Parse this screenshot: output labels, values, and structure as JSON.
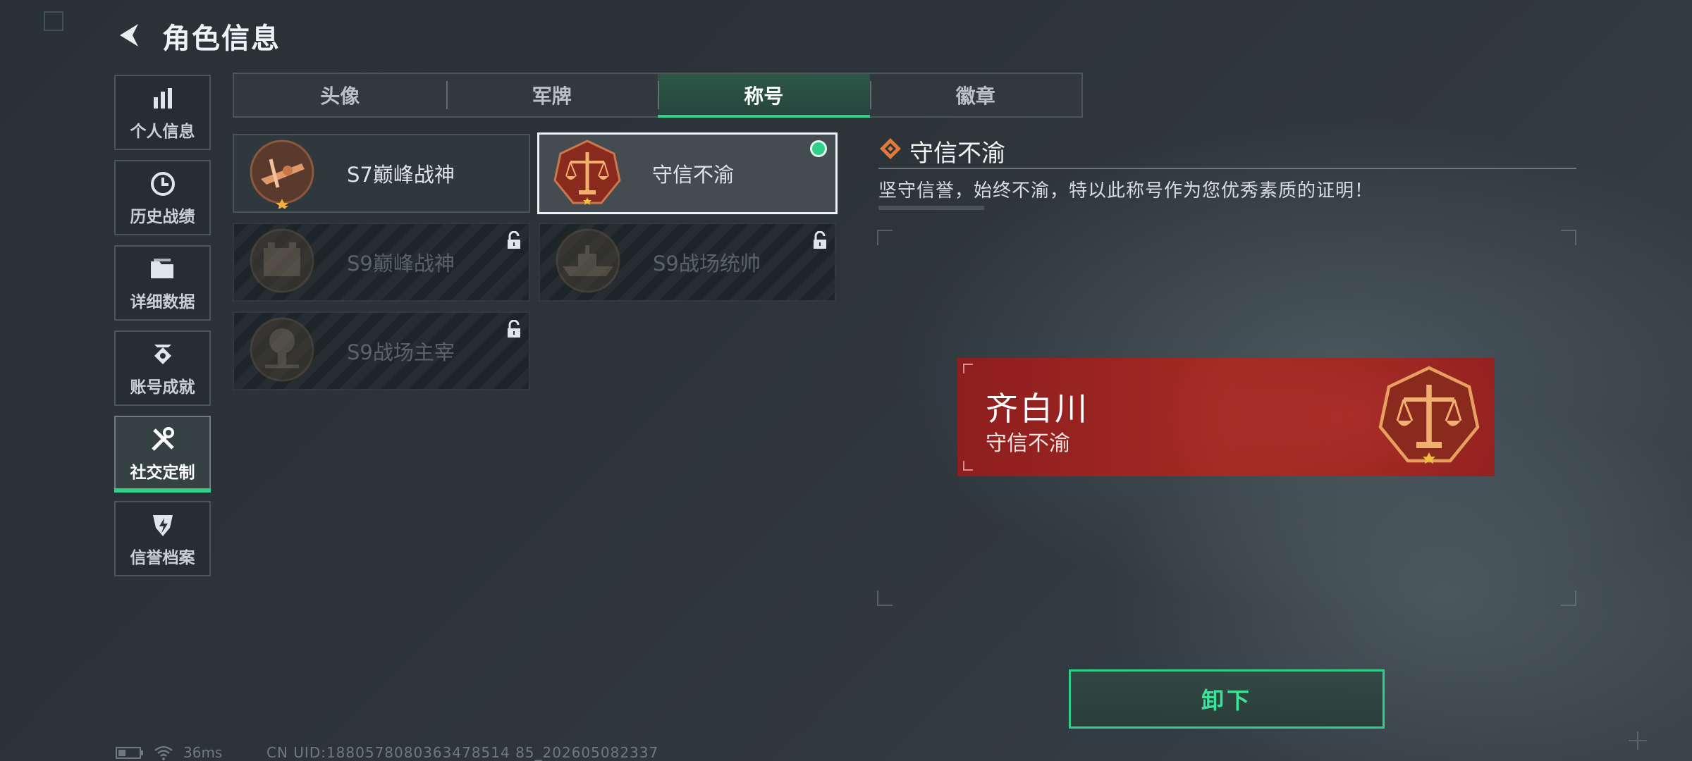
{
  "header": {
    "title": "角色信息",
    "back_icon": "back-arrow-icon"
  },
  "sidebar": {
    "items": [
      {
        "label": "个人信息",
        "icon": "bar-chart-icon",
        "active": false
      },
      {
        "label": "历史战绩",
        "icon": "clock-icon",
        "active": false
      },
      {
        "label": "详细数据",
        "icon": "folder-icon",
        "active": false
      },
      {
        "label": "账号成就",
        "icon": "badge-icon",
        "active": false
      },
      {
        "label": "社交定制",
        "icon": "tools-icon",
        "active": true
      },
      {
        "label": "信誉档案",
        "icon": "shield-bolt-icon",
        "active": false
      }
    ]
  },
  "tabs": [
    {
      "label": "头像",
      "active": false
    },
    {
      "label": "军牌",
      "active": false
    },
    {
      "label": "称号",
      "active": true
    },
    {
      "label": "徽章",
      "active": false
    }
  ],
  "titles": [
    {
      "name": "S7巅峰战神",
      "locked": false,
      "selected": false,
      "emblem": "crossbow-emblem-icon"
    },
    {
      "name": "守信不渝",
      "locked": false,
      "selected": true,
      "equipped": true,
      "emblem": "scales-emblem-icon"
    },
    {
      "name": "S9巅峰战神",
      "locked": true,
      "selected": false,
      "emblem": "fortress-emblem-icon"
    },
    {
      "name": "S9战场统帅",
      "locked": true,
      "selected": false,
      "emblem": "warship-emblem-icon"
    },
    {
      "name": "S9战场主宰",
      "locked": true,
      "selected": false,
      "emblem": "explosion-emblem-icon"
    }
  ],
  "detail": {
    "title": "守信不渝",
    "description": "坚守信誉，始终不渝，特以此称号作为您优秀素质的证明！"
  },
  "banner": {
    "player_name": "齐白川",
    "title": "守信不渝"
  },
  "actions": {
    "unequip_label": "卸下"
  },
  "status": {
    "ping": "36ms",
    "uid": "CN UID:1880578080363478514 85_202605082337"
  },
  "colors": {
    "accent": "#2fd08a",
    "banner_red": "#a32a25",
    "emblem_orange": "#e07a3a"
  }
}
